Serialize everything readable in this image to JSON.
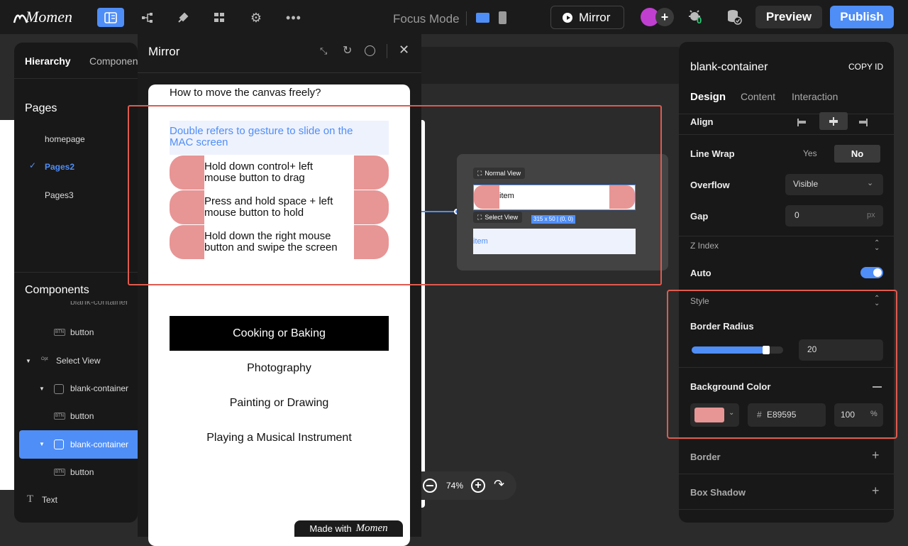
{
  "topbar": {
    "logo": "Momen",
    "focus_mode": "Focus Mode",
    "mirror_label": "Mirror",
    "badge_count": "0",
    "preview_label": "Preview",
    "publish_label": "Publish"
  },
  "left_panel": {
    "tabs": [
      "Hierarchy",
      "Componen"
    ],
    "pages_title": "Pages",
    "pages": [
      "homepage",
      "Pages2",
      "Pages3"
    ],
    "components_title": "Components",
    "components": [
      {
        "label": "blank-container",
        "tag": ""
      },
      {
        "label": "button",
        "tag": "BTN"
      },
      {
        "label": "Select View",
        "tag": "Opt"
      },
      {
        "label": "blank-container",
        "tag": ""
      },
      {
        "label": "button",
        "tag": "BTN"
      },
      {
        "label": "blank-container",
        "tag": ""
      },
      {
        "label": "button",
        "tag": "BTN"
      },
      {
        "label": "Text",
        "tag": ""
      }
    ]
  },
  "mirror": {
    "title": "Mirror",
    "question": "How to move the canvas freely?",
    "answer_selected": "Double refers to gesture to slide on the MAC screen",
    "answers": [
      "Hold down control+ left mouse button to drag",
      "Press and hold space + left mouse button to hold",
      "Hold down the right mouse button and swipe the screen"
    ],
    "options": [
      "Cooking or Baking",
      "Photography",
      "Painting or Drawing",
      "Playing a Musical Instrument"
    ],
    "made_with": "Made with",
    "made_with_brand": "Momen"
  },
  "canvas": {
    "normal_view_label": "Normal View",
    "item1": "item",
    "select_view_label": "Select View",
    "size_badge": "315 x 50 | (0, 0)",
    "item2": "item",
    "zoom": "74%"
  },
  "right_panel": {
    "component_name": "blank-container",
    "copy_id": "COPY ID",
    "tabs": [
      "Design",
      "Content",
      "Interaction"
    ],
    "align_label": "Align",
    "line_wrap_label": "Line Wrap",
    "line_wrap_yes": "Yes",
    "line_wrap_no": "No",
    "overflow_label": "Overflow",
    "overflow_value": "Visible",
    "gap_label": "Gap",
    "gap_value": "0",
    "gap_unit": "px",
    "z_index_label": "Z Index",
    "auto_label": "Auto",
    "style_label": "Style",
    "border_radius_label": "Border Radius",
    "border_radius_value": "20",
    "border_radius_fraction": 0.8,
    "bg_color_label": "Background Color",
    "bg_hash": "#",
    "bg_hex": "E89595",
    "bg_opacity": "100",
    "bg_opacity_unit": "%",
    "border_label": "Border",
    "box_shadow_label": "Box Shadow"
  },
  "colors": {
    "accent": "#4f8ef7",
    "pink": "#e89595",
    "highlight": "#e05a4f",
    "selected_bg": "#eef2fc"
  }
}
